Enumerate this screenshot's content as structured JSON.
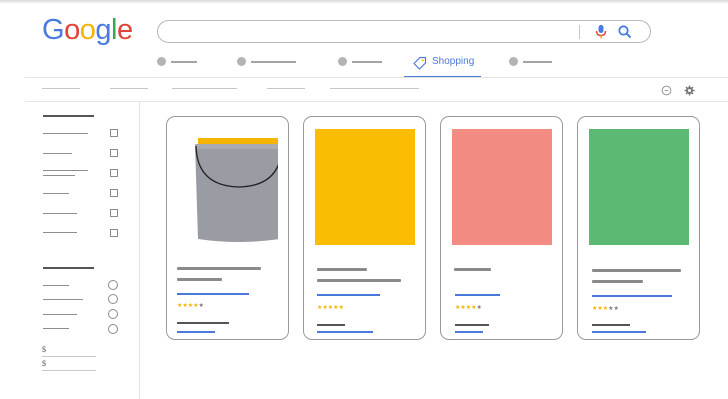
{
  "logo": {
    "letters": [
      "G",
      "o",
      "o",
      "g",
      "l",
      "e"
    ],
    "colors": [
      "#4a7ae0",
      "#e04436",
      "#f5b400",
      "#4a7ae0",
      "#34a853",
      "#e04436"
    ]
  },
  "search": {
    "value": "",
    "placeholder": ""
  },
  "tabs": {
    "active_label": "Shopping"
  },
  "colors": {
    "accent": "#4a79d9",
    "star": "#f5b400"
  },
  "icons": [
    "mic-icon",
    "search-icon",
    "price-tag-icon",
    "history-icon",
    "gear-icon"
  ],
  "sidebar": {
    "price_symbol_1": "$",
    "price_symbol_2": "$"
  },
  "products": [
    {
      "image": "paint-bucket",
      "image_color": "#999ca3",
      "rating": 4,
      "max_rating": 5
    },
    {
      "image": "yellow-swatch",
      "image_color": "#fbbc04",
      "rating": 5,
      "max_rating": 5
    },
    {
      "image": "red-swatch",
      "image_color": "#f28b82",
      "rating": 4,
      "max_rating": 5
    },
    {
      "image": "green-swatch",
      "image_color": "#5bb974",
      "rating": 3,
      "max_rating": 5
    }
  ]
}
